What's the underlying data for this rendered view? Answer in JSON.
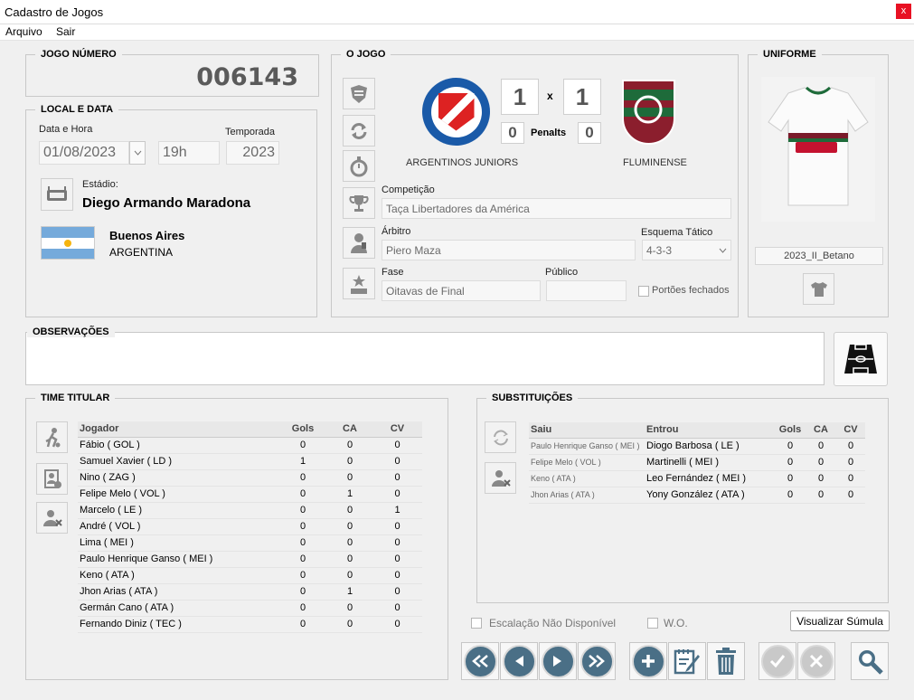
{
  "window": {
    "title": "Cadastro de Jogos",
    "close_label": "x"
  },
  "menu": [
    "Arquivo",
    "Sair"
  ],
  "jogo_numero": {
    "title": "JOGO NÚMERO",
    "value": "006143"
  },
  "local_data": {
    "title": "LOCAL E DATA",
    "data_hora_label": "Data e Hora",
    "temporada_label": "Temporada",
    "date": "01/08/2023",
    "hour": "19h",
    "season": "2023",
    "estadio_label": "Estádio:",
    "estadio": "Diego Armando Maradona",
    "city": "Buenos Aires",
    "country": "ARGENTINA"
  },
  "o_jogo": {
    "title": "O JOGO",
    "home_team": "ARGENTINOS JUNIORS",
    "away_team": "FLUMINENSE",
    "home_score": "1",
    "away_score": "1",
    "x_label": "x",
    "home_penalties": "0",
    "away_penalties": "0",
    "penalties_label": "Penalts",
    "competicao_label": "Competição",
    "competicao": "Taça Libertadores da América",
    "arbitro_label": "Árbitro",
    "arbitro": "Piero Maza",
    "esquema_label": "Esquema Tático",
    "esquema": "4-3-3",
    "fase_label": "Fase",
    "fase": "Oitavas de Final",
    "publico_label": "Público",
    "publico": "",
    "portoes_label": "Portões fechados"
  },
  "uniforme": {
    "title": "UNIFORME",
    "name": "2023_II_Betano"
  },
  "observacoes": {
    "title": "OBSERVAÇÕES",
    "value": ""
  },
  "time_titular": {
    "title": "TIME TITULAR",
    "headers": [
      "Jogador",
      "Gols",
      "CA",
      "CV"
    ],
    "rows": [
      [
        "Fábio ( GOL )",
        "0",
        "0",
        "0"
      ],
      [
        "Samuel Xavier ( LD )",
        "1",
        "0",
        "0"
      ],
      [
        "Nino ( ZAG )",
        "0",
        "0",
        "0"
      ],
      [
        "Felipe Melo ( VOL )",
        "0",
        "1",
        "0"
      ],
      [
        "Marcelo ( LE )",
        "0",
        "0",
        "1"
      ],
      [
        "André ( VOL )",
        "0",
        "0",
        "0"
      ],
      [
        "Lima ( MEI )",
        "0",
        "0",
        "0"
      ],
      [
        "Paulo Henrique Ganso ( MEI )",
        "0",
        "0",
        "0"
      ],
      [
        "Keno ( ATA )",
        "0",
        "0",
        "0"
      ],
      [
        "Jhon Arias ( ATA )",
        "0",
        "1",
        "0"
      ],
      [
        "Germán Cano ( ATA )",
        "0",
        "0",
        "0"
      ],
      [
        "Fernando Diniz ( TEC )",
        "0",
        "0",
        "0"
      ]
    ]
  },
  "substituicoes": {
    "title": "SUBSTITUIÇÕES",
    "headers": [
      "Saiu",
      "Entrou",
      "Gols",
      "CA",
      "CV"
    ],
    "rows": [
      [
        "Paulo Henrique Ganso ( MEI )",
        "Diogo Barbosa ( LE )",
        "0",
        "0",
        "0"
      ],
      [
        "Felipe Melo ( VOL )",
        "Martinelli ( MEI )",
        "0",
        "0",
        "0"
      ],
      [
        "Keno ( ATA )",
        "Leo Fernández ( MEI )",
        "0",
        "0",
        "0"
      ],
      [
        "Jhon Arias ( ATA )",
        "Yony González ( ATA )",
        "0",
        "0",
        "0"
      ]
    ]
  },
  "bottom": {
    "escalacao_label": "Escalação Não Disponível",
    "wo_label": "W.O.",
    "visualizar_label": "Visualizar Súmula"
  },
  "colors": {
    "nav_button": "#4a6f86",
    "disabled_button": "#c9c9c9",
    "fluminense_green": "#1e6b3a",
    "fluminense_maroon": "#8b1e2d"
  }
}
